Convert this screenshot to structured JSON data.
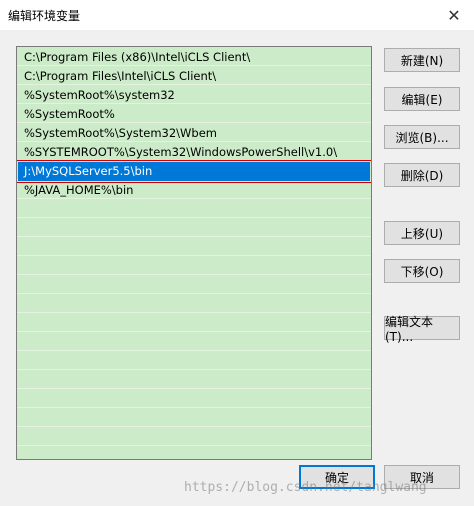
{
  "window": {
    "title": "编辑环境变量",
    "close_label": "✕"
  },
  "paths": [
    "C:\\Program Files (x86)\\Intel\\iCLS Client\\",
    "C:\\Program Files\\Intel\\iCLS Client\\",
    "%SystemRoot%\\system32",
    "%SystemRoot%",
    "%SystemRoot%\\System32\\Wbem",
    "%SYSTEMROOT%\\System32\\WindowsPowerShell\\v1.0\\",
    "J:\\MySQLServer5.5\\bin",
    "%JAVA_HOME%\\bin"
  ],
  "selected_index": 6,
  "buttons": {
    "new": "新建(N)",
    "edit": "编辑(E)",
    "browse": "浏览(B)...",
    "delete": "删除(D)",
    "move_up": "上移(U)",
    "move_down": "下移(O)",
    "edit_text": "编辑文本(T)...",
    "ok": "确定",
    "cancel": "取消"
  },
  "watermark": "https://blog.csdn.net/tanglwang"
}
